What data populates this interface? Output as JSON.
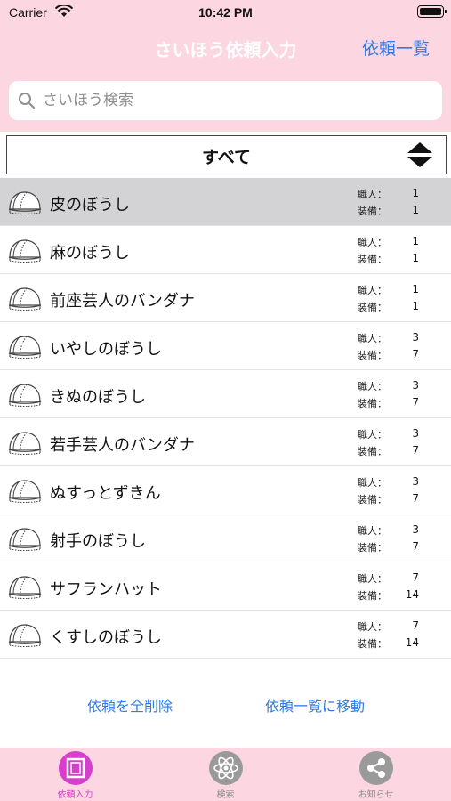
{
  "status": {
    "carrier": "Carrier",
    "time": "10:42 PM"
  },
  "nav": {
    "title": "さいほう依頼入力",
    "right_button": "依頼一覧"
  },
  "search": {
    "placeholder": "さいほう検索",
    "value": ""
  },
  "filter": {
    "label": "すべて"
  },
  "stat_labels": {
    "crafter": "職人：",
    "equip": "装備："
  },
  "items": [
    {
      "name": "皮のぼうし",
      "crafter": "1",
      "equip": "1",
      "selected": true
    },
    {
      "name": "麻のぼうし",
      "crafter": "1",
      "equip": "1"
    },
    {
      "name": "前座芸人のバンダナ",
      "crafter": "1",
      "equip": "1"
    },
    {
      "name": "いやしのぼうし",
      "crafter": "3",
      "equip": "7"
    },
    {
      "name": "きぬのぼうし",
      "crafter": "3",
      "equip": "7"
    },
    {
      "name": "若手芸人のバンダナ",
      "crafter": "3",
      "equip": "7"
    },
    {
      "name": "ぬすっとずきん",
      "crafter": "3",
      "equip": "7"
    },
    {
      "name": "射手のぼうし",
      "crafter": "3",
      "equip": "7"
    },
    {
      "name": "サフランハット",
      "crafter": "7",
      "equip": "14"
    },
    {
      "name": "くすしのぼうし",
      "crafter": "7",
      "equip": "14"
    }
  ],
  "actions": {
    "delete_all": "依頼を全削除",
    "go_to_list": "依頼一覧に移動"
  },
  "tabs": [
    {
      "label": "依頼入力",
      "icon": "request-input-icon",
      "active": true
    },
    {
      "label": "検索",
      "icon": "atom-search-icon"
    },
    {
      "label": "お知らせ",
      "icon": "share-notice-icon"
    }
  ],
  "colors": {
    "accent_pink": "#fcd6e0",
    "link_blue": "#2f7ae5",
    "active_tab": "#d63ecb"
  }
}
